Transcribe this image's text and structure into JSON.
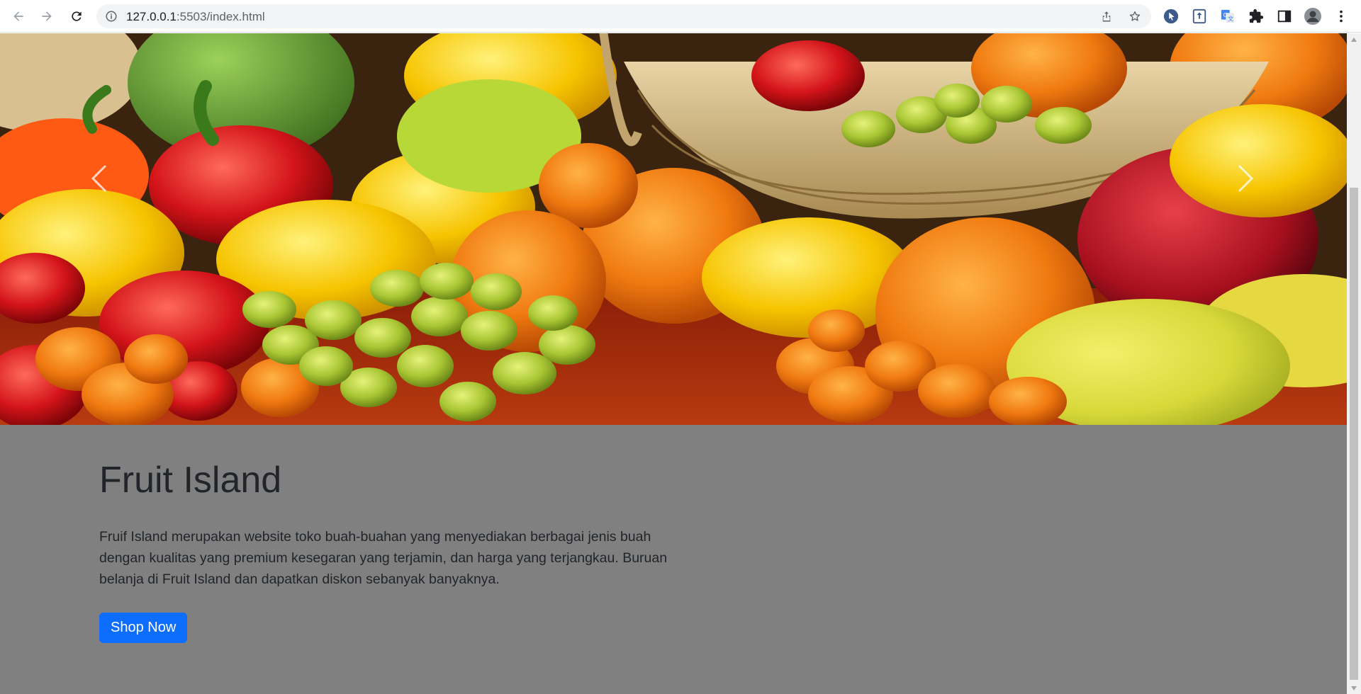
{
  "browser": {
    "url_host": "127.0.0.1",
    "url_path": ":5503/index.html",
    "back_icon": "arrow-left-icon",
    "forward_icon": "arrow-right-icon",
    "reload_icon": "reload-icon",
    "info_icon": "info-icon",
    "share_icon": "share-icon",
    "bookmark_icon": "star-icon",
    "extensions": [
      "cursor-extension-icon",
      "upload-extension-icon",
      "translate-extension-icon",
      "puzzle-icon"
    ],
    "side_panel_icon": "side-panel-icon",
    "menu_icon": "kebab-menu-icon"
  },
  "carousel": {
    "prev_icon": "chevron-left-icon",
    "next_icon": "chevron-right-icon"
  },
  "hero_text": {
    "title": "Fruit Island",
    "description": "Fruif Island merupakan website toko buah-buahan yang menyediakan berbagai jenis buah dengan kualitas yang premium kesegaran yang terjamin, dan harga yang terjangkau. Buruan belanja di Fruit Island dan dapatkan diskon sebanyak banyaknya.",
    "button_label": "Shop Now"
  },
  "colors": {
    "page_background": "#808080",
    "heading_text": "#212529",
    "button_primary": "#0d6efd"
  }
}
